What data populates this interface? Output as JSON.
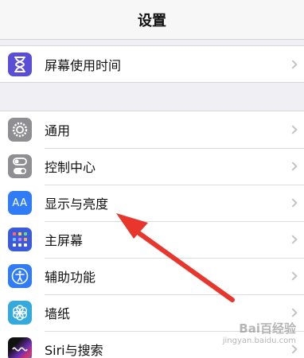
{
  "nav": {
    "title": "设置"
  },
  "group1": [
    {
      "label": "屏幕使用时间",
      "icon": "hourglass-icon"
    }
  ],
  "group2": [
    {
      "label": "通用",
      "icon": "gear-icon"
    },
    {
      "label": "控制中心",
      "icon": "toggles-icon"
    },
    {
      "label": "显示与亮度",
      "icon": "text-size-icon",
      "icon_text": "AA"
    },
    {
      "label": "主屏幕",
      "icon": "app-grid-icon"
    },
    {
      "label": "辅助功能",
      "icon": "accessibility-icon"
    },
    {
      "label": "墙纸",
      "icon": "flower-icon"
    },
    {
      "label": "Siri与搜索",
      "icon": "siri-icon"
    }
  ],
  "annotation": {
    "type": "red-arrow",
    "points_to": "显示与亮度",
    "color": "#e8362d"
  },
  "watermark": {
    "text": "Bai百经验",
    "sub": "jingyan.baidu.com"
  }
}
